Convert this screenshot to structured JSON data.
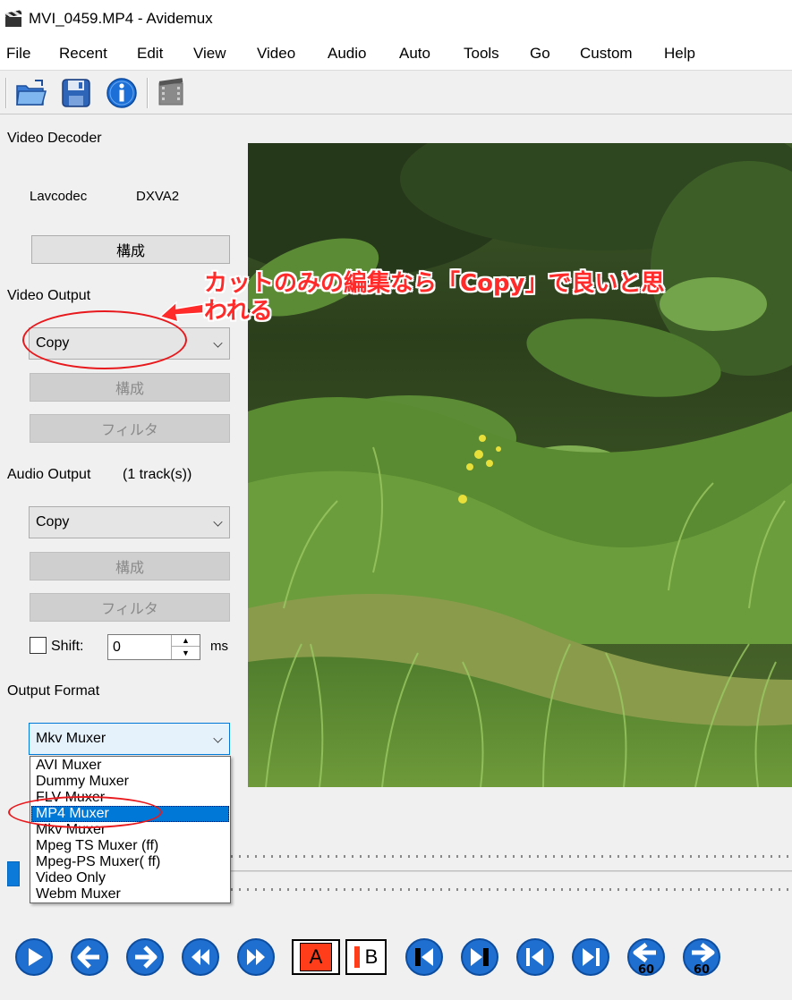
{
  "window": {
    "title": "MVI_0459.MP4 - Avidemux"
  },
  "menu": [
    "File",
    "Recent",
    "Edit",
    "View",
    "Video",
    "Audio",
    "Auto",
    "Tools",
    "Go",
    "Custom",
    "Help"
  ],
  "toolbar": {
    "icons": [
      "open-folder-icon",
      "save-disk-icon",
      "info-icon",
      "film-icon"
    ]
  },
  "video_decoder": {
    "title": "Video Decoder",
    "codec": "Lavcodec",
    "hw": "DXVA2",
    "configure_label": "構成"
  },
  "video_output": {
    "title": "Video Output",
    "selected": "Copy",
    "configure_label": "構成",
    "filter_label": "フィルタ"
  },
  "audio_output": {
    "title": "Audio Output",
    "tracks": "(1 track(s))",
    "selected": "Copy",
    "configure_label": "構成",
    "filter_label": "フィルタ",
    "shift_label": "Shift:",
    "shift_value": "0",
    "shift_unit": "ms"
  },
  "output_format": {
    "title": "Output Format",
    "selected": "Mkv Muxer",
    "options": [
      "AVI Muxer",
      "Dummy Muxer",
      "FLV Muxer",
      "MP4 Muxer",
      "Mkv Muxer",
      "Mpeg TS Muxer (ff)",
      "Mpeg-PS Muxer( ff)",
      "Video Only",
      "Webm Muxer"
    ],
    "highlighted": "MP4 Muxer"
  },
  "annotation": {
    "line1": "カットのみの編集なら「Copy」で良いと思",
    "line2": "われる",
    "color": "#ff2a2a"
  },
  "navigation": {
    "buttons": [
      "play-icon",
      "previous-frame-icon",
      "next-frame-icon",
      "rewind-icon",
      "fast-forward-icon",
      "marker-a-icon",
      "marker-b-icon",
      "previous-keyframe-icon",
      "next-keyframe-icon",
      "go-start-icon",
      "go-end-icon",
      "back-60-icon",
      "forward-60-icon"
    ],
    "marker_a": "A",
    "marker_b": "B",
    "jump_label": "60"
  },
  "accent_color": "#0078d7"
}
